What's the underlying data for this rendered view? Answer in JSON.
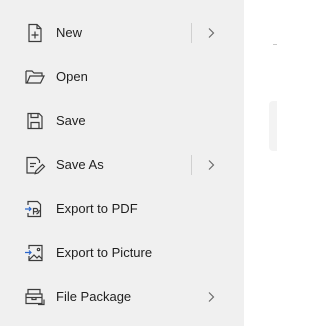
{
  "menu": {
    "items": [
      {
        "label": "New",
        "icon": "new-file-icon",
        "has_submenu": true
      },
      {
        "label": "Open",
        "icon": "open-folder-icon",
        "has_submenu": false
      },
      {
        "label": "Save",
        "icon": "save-icon",
        "has_submenu": false
      },
      {
        "label": "Save As",
        "icon": "save-as-icon",
        "has_submenu": true
      },
      {
        "label": "Export to PDF",
        "icon": "export-pdf-icon",
        "has_submenu": false
      },
      {
        "label": "Export to Picture",
        "icon": "export-picture-icon",
        "has_submenu": false
      },
      {
        "label": "File Package",
        "icon": "file-package-icon",
        "has_submenu": true
      }
    ]
  },
  "colors": {
    "menu_background": "#f0f0f0",
    "icon_stroke": "#3c3c3c",
    "accent_blue": "#2b66c9"
  }
}
